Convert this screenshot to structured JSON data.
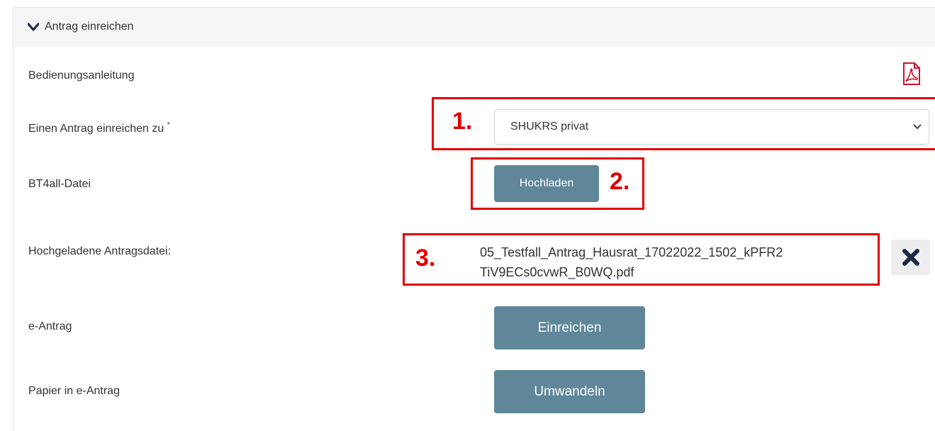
{
  "section": {
    "title": "Antrag einreichen",
    "chevron_icon": "chevron-down-icon"
  },
  "rows": {
    "manual_label": "Bedienungsanleitung",
    "manual_icon": "pdf-icon",
    "submit_to_label": "Einen Antrag einreichen zu",
    "required_marker": "*",
    "file_label": "BT4all-Datei",
    "uploaded_label": "Hochgeladene Antragsdateі:",
    "eantrag_label": "e-Antrag",
    "paper_label": "Papier in e-Antrag"
  },
  "controls": {
    "select_value": "SHUKRS privat",
    "upload_button": "Hochladen",
    "uploaded_filename_line1": "05_Testfall_Antrag_Hausrat_17022022_1502_kPFR2",
    "uploaded_filename_line2": "TiV9ECs0cvwR_B0WQ.pdf",
    "delete_icon": "close-icon",
    "submit_button": "Einreichen",
    "convert_button": "Umwandeln"
  },
  "annotations": {
    "step1": "1.",
    "step2": "2.",
    "step3": "3."
  },
  "colors": {
    "button": "#5f8799",
    "annotation": "#e10000",
    "pdf_icon": "#d0112b"
  }
}
